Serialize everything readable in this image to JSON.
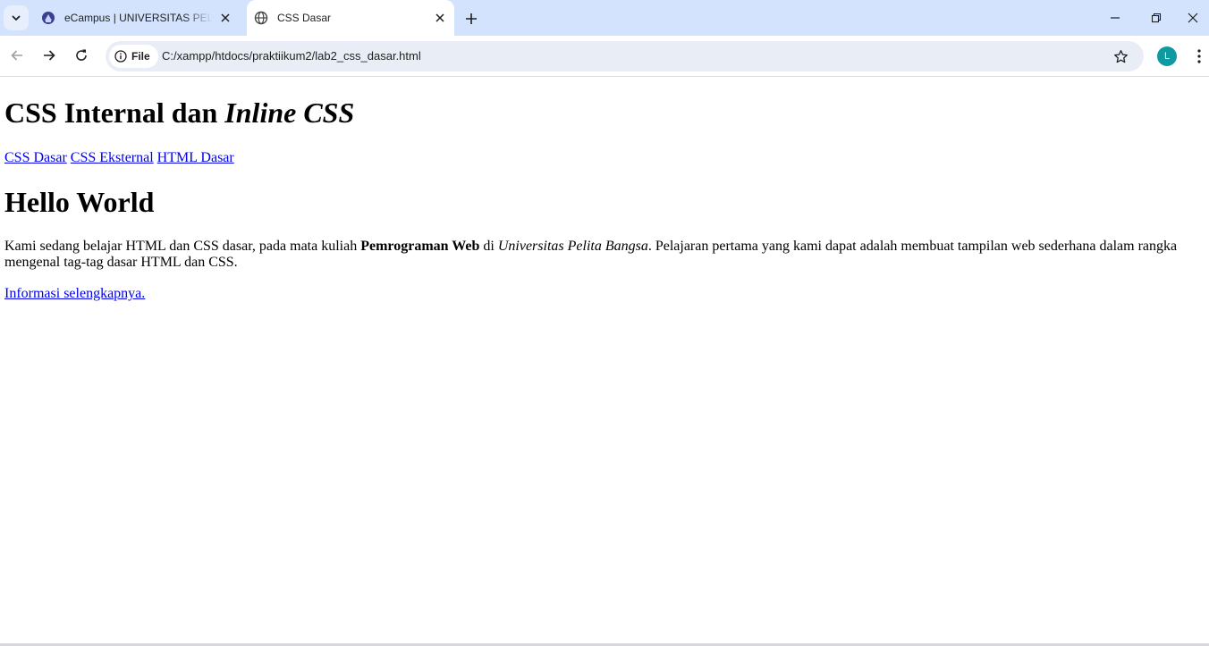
{
  "browser": {
    "tabs": [
      {
        "title": "eCampus | UNIVERSITAS PELITA BANGSA",
        "active": false,
        "icon": "university-logo-icon"
      },
      {
        "title": "CSS Dasar",
        "active": true,
        "icon": "globe-icon"
      }
    ],
    "address": {
      "chip_label": "File",
      "url": "C:/xampp/htdocs/praktiikum2/lab2_css_dasar.html"
    },
    "profile_initial": "L",
    "colors": {
      "tabstrip": "#d3e3fd",
      "omnibox": "#e9eef6",
      "avatar": "#0f9aa0"
    }
  },
  "page": {
    "title_plain": "CSS Internal dan ",
    "title_italic": "Inline CSS",
    "nav": [
      "CSS Dasar",
      "CSS Eksternal",
      "HTML Dasar"
    ],
    "heading": "Hello World",
    "paragraph": {
      "part1": "Kami sedang belajar HTML dan CSS dasar, pada mata kuliah ",
      "bold": "Pemrograman Web",
      "part2": " di ",
      "italic": "Universitas Pelita Bangsa",
      "part3": ". Pelajaran pertama yang kami dapat adalah membuat tampilan web sederhana dalam rangka mengenal tag-tag dasar HTML dan CSS."
    },
    "more_link": "Informasi selengkapnya."
  }
}
